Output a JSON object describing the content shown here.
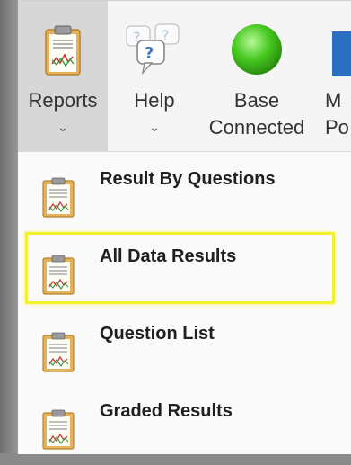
{
  "ribbon": {
    "buttons": [
      {
        "name": "reports",
        "label": "Reports",
        "icon": "clipboard-chart-icon",
        "has_dropdown": true,
        "active": true
      },
      {
        "name": "help",
        "label": "Help",
        "icon": "help-bubbles-icon",
        "has_dropdown": true
      },
      {
        "name": "base",
        "label_line1": "Base",
        "label_line2": "Connected",
        "icon": "green-status-icon"
      },
      {
        "name": "partial",
        "label_line1": "M",
        "label_line2": "Po"
      }
    ],
    "reports_label": "Reports",
    "help_label": "Help",
    "base_line1": "Base",
    "base_line2": "Connected",
    "partial_line1": "M",
    "partial_line2": "Po",
    "chevron": "⌄",
    "status_color": "#3fc71f"
  },
  "menu": {
    "items": [
      {
        "label": "Result By Questions",
        "icon": "report-clipboard-icon"
      },
      {
        "label": "All Data Results",
        "icon": "report-clipboard-icon",
        "highlighted": true
      },
      {
        "label": "Question List",
        "icon": "report-clipboard-icon"
      },
      {
        "label": "Graded Results",
        "icon": "report-clipboard-icon"
      }
    ],
    "highlight_color": "#f2f032"
  }
}
